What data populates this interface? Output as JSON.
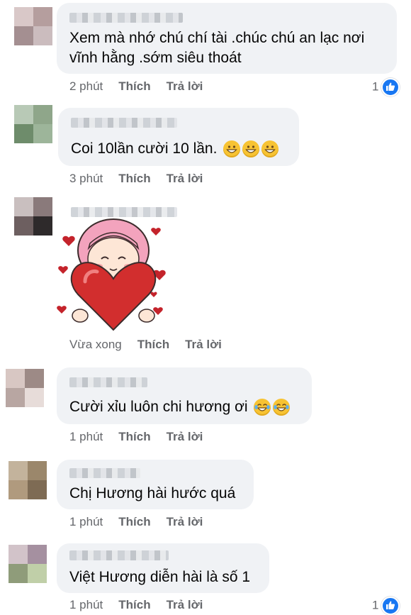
{
  "comments": [
    {
      "text_lines": [
        "Xem mà nhớ chú chí tài .chúc chú an lạc nơi",
        "vĩnh hằng .sớm siêu thoát"
      ],
      "time": "2 phút",
      "like": "Thích",
      "reply": "Trả lời",
      "reactions": "1"
    },
    {
      "text": "Coi 10lần cười 10 lần.",
      "time": "3 phút",
      "like": "Thích",
      "reply": "Trả lời",
      "emoji_count": 3,
      "emoji": "grinning-face"
    },
    {
      "sticker": "girl-holding-heart-sticker",
      "time": "Vừa xong",
      "like": "Thích",
      "reply": "Trả lời"
    },
    {
      "text": "Cười xỉu luôn chi hương ơi",
      "time": "1 phút",
      "like": "Thích",
      "reply": "Trả lời",
      "emoji_count": 2,
      "emoji": "tears-of-joy-face"
    },
    {
      "text": "Chị Hương hài hước quá",
      "time": "1 phút",
      "like": "Thích",
      "reply": "Trả lời"
    },
    {
      "text": "Việt Hương diễn hài là số 1",
      "time": "1 phút",
      "like": "Thích",
      "reply": "Trả lời",
      "reactions": "1"
    }
  ],
  "colors": {
    "bubble": "#f0f2f5",
    "meta": "#65676b",
    "like_blue": "#1877f2",
    "emoji_yellow": "#f7c333"
  }
}
